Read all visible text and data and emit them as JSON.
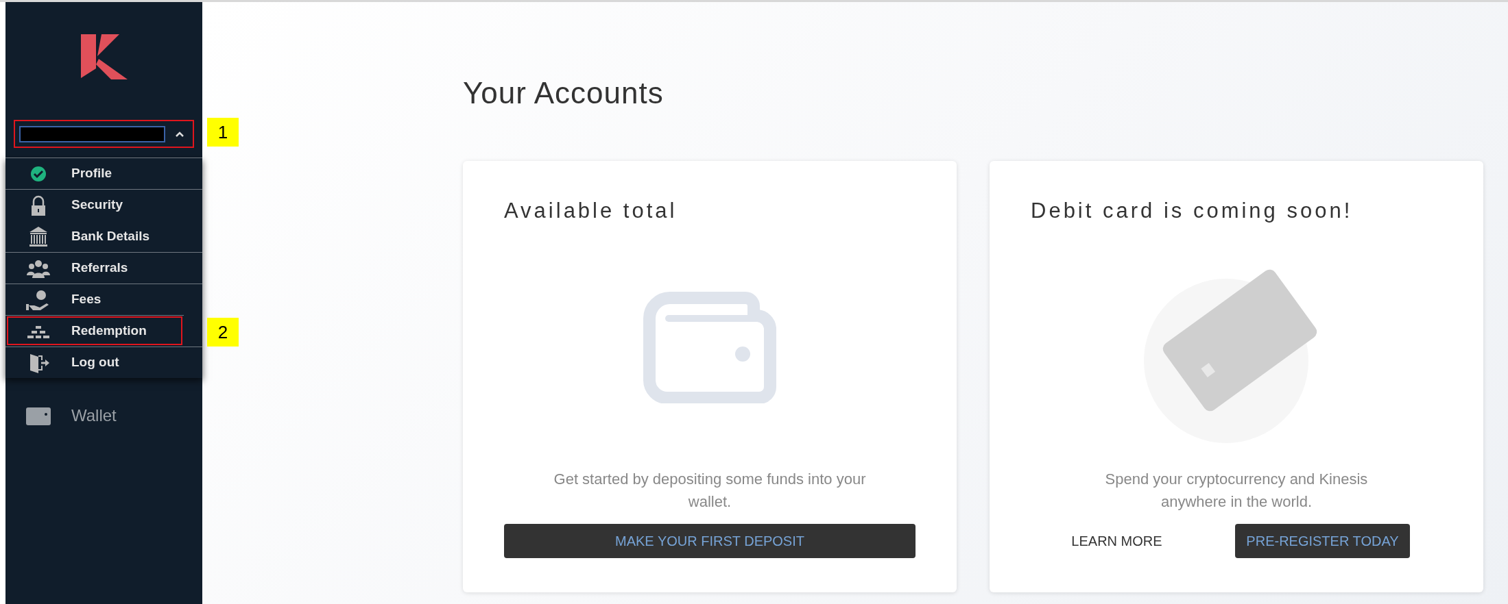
{
  "sidebar": {
    "account_selector": {
      "expanded": true,
      "annotation": "1"
    },
    "menu": [
      {
        "label": "Profile",
        "kind": "verified",
        "group_start": true
      },
      {
        "label": "Security",
        "kind": "lock",
        "group_start": true
      },
      {
        "label": "Bank Details",
        "kind": "bank",
        "group_start": false
      },
      {
        "label": "Referrals",
        "kind": "people",
        "group_start": true
      },
      {
        "label": "Fees",
        "kind": "fees",
        "group_start": true
      },
      {
        "label": "Redemption",
        "kind": "bars",
        "group_start": true,
        "annotation": "2"
      },
      {
        "label": "Log out",
        "kind": "logout",
        "group_start": true
      }
    ],
    "nav_items": [
      {
        "label": "Wallet"
      }
    ]
  },
  "main": {
    "title": "Your Accounts",
    "cards": [
      {
        "kind": "wallet",
        "title": "Available total",
        "text": "Get started by depositing some funds into your wallet.",
        "buttons": [
          {
            "label": "MAKE YOUR FIRST DEPOSIT",
            "kind": "primary"
          }
        ]
      },
      {
        "kind": "debit",
        "title": "Debit card is coming soon!",
        "text": "Spend your cryptocurrency and Kinesis anywhere in the world.",
        "buttons": [
          {
            "label": "LEARN MORE",
            "kind": "link"
          },
          {
            "label": "PRE-REGISTER TODAY",
            "kind": "primary"
          }
        ]
      }
    ]
  }
}
